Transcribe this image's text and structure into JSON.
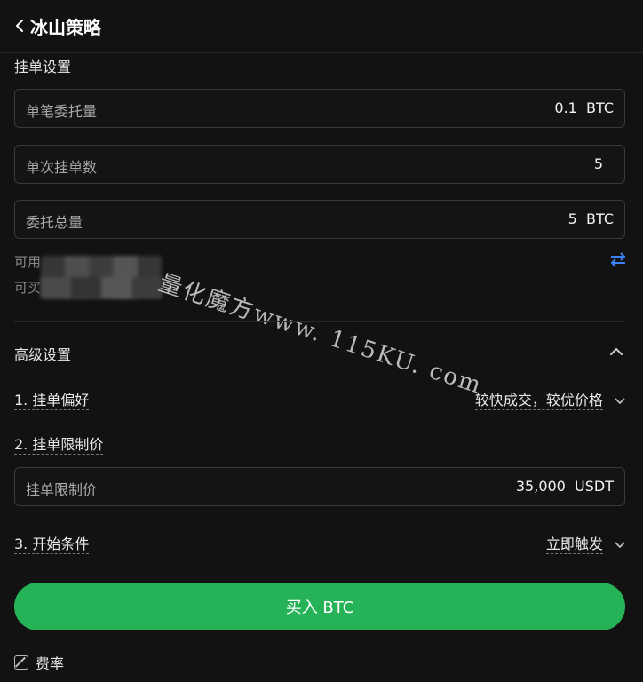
{
  "header": {
    "title": "冰山策略"
  },
  "order_settings": {
    "section_label": "挂单设置",
    "fields": [
      {
        "label": "单笔委托量",
        "value": "0.1  BTC"
      },
      {
        "label": "单次挂单数",
        "value": "5"
      },
      {
        "label": "委托总量",
        "value": "5  BTC"
      }
    ],
    "available_label": "可用",
    "can_buy_label": "可买"
  },
  "advanced": {
    "section_label": "高级设置",
    "preference_label": "1. 挂单偏好",
    "preference_value": "较快成交，较优价格",
    "limit_label": "2. 挂单限制价",
    "limit_field_label": "挂单限制价",
    "limit_field_value": "35,000  USDT",
    "start_label": "3. 开始条件",
    "start_value": "立即触发"
  },
  "buy_button": {
    "label": "买入 BTC"
  },
  "fee": {
    "label": "费率"
  },
  "watermark": "量化魔方www. 115KU. com",
  "colors": {
    "accent_green": "#26b358",
    "swap_blue": "#3b82f6",
    "background": "#121212"
  }
}
